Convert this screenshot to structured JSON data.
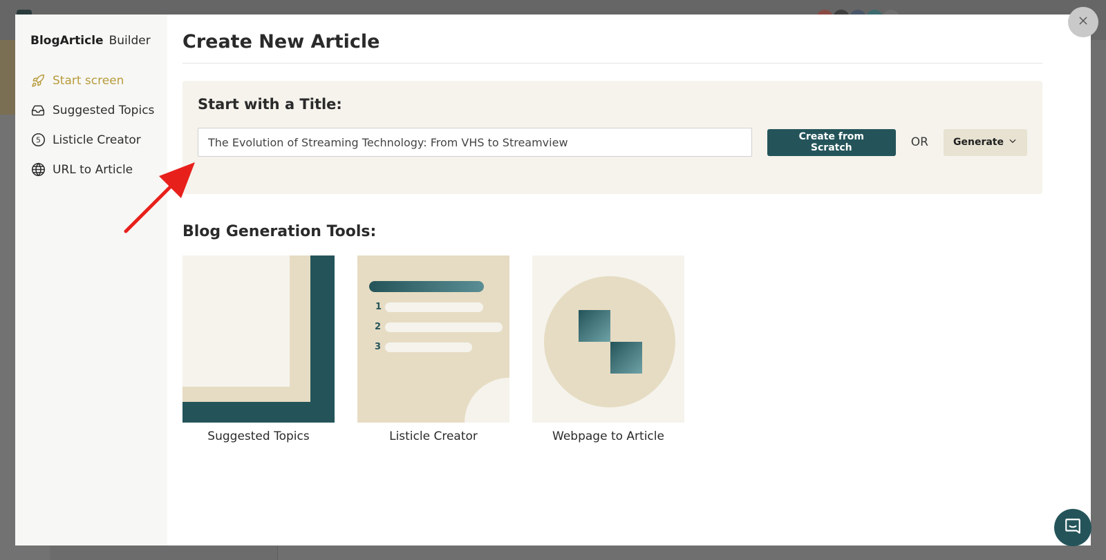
{
  "modal": {
    "brand": {
      "name": "BlogArticle",
      "suffix": "Builder"
    },
    "nav": [
      {
        "label": "Start screen",
        "icon": "rocket-icon",
        "active": true
      },
      {
        "label": "Suggested Topics",
        "icon": "inbox-icon",
        "active": false
      },
      {
        "label": "Listicle Creator",
        "icon": "number-five-icon",
        "active": false
      },
      {
        "label": "URL to Article",
        "icon": "globe-icon",
        "active": false
      }
    ],
    "title": "Create New Article",
    "start": {
      "heading": "Start with a Title:",
      "input_value": "The Evolution of Streaming Technology: From VHS to Streamview",
      "create_label": "Create from Scratch",
      "or_label": "OR",
      "generate_label": "Generate"
    },
    "tools": {
      "heading": "Blog Generation Tools:",
      "cards": [
        {
          "label": "Suggested Topics"
        },
        {
          "label": "Listicle Creator",
          "numbers": [
            "1",
            "2",
            "3"
          ]
        },
        {
          "label": "Webpage to Article"
        }
      ]
    }
  },
  "colors": {
    "accent_teal": "#24545a",
    "accent_gold": "#b89b3b",
    "panel_beige": "#f5f3ec",
    "thumb_beige": "#e6dcc3",
    "annotation_red": "#e8201c"
  }
}
